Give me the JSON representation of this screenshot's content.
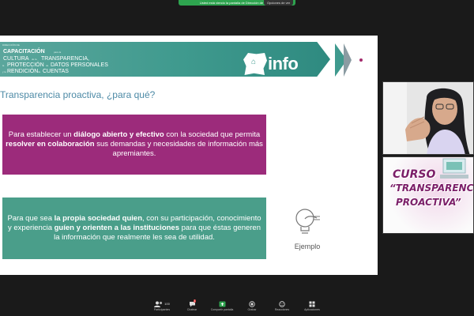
{
  "top_bar": {
    "share_notice": "Usted está viendo la pantalla de Dirección de Capa...",
    "view_options": "Opciones de ver"
  },
  "slide": {
    "banner": {
      "line1_prefix": "DIRECCIÓN DE",
      "line1": "CAPACITACIÓN",
      "line1_suffix": "para la",
      "line2": "CULTURA",
      "line2_mid": "de la",
      "line2b": "TRANSPARENCIA,",
      "line3_prefix": "la",
      "line3": "PROTECCIÓN",
      "line3_mid": "de",
      "line3b": "DATOS PERSONALES",
      "line4_prefix": "y la",
      "line4": "RENDICIÓN",
      "line4_mid": "de",
      "line4b": "CUENTAS"
    },
    "logo_text": "info",
    "heading": "Transparencia proactiva, ¿para qué?",
    "box1": {
      "t1": "Para establecer un ",
      "b1": "diálogo abierto y efectivo",
      "t2": " con la sociedad que permita ",
      "b2": "resolver en colaboración",
      "t3": " sus demandas y necesidades de información más apremiantes."
    },
    "box2": {
      "t1": "Para que sea ",
      "b1": "la propia sociedad quien",
      "t2": ", con su participación, conocimiento y experiencia ",
      "b2": "guíen y orienten a las instituciones",
      "t3": " para que éstas generen la información que realmente les sea de utilidad."
    },
    "ejemplo_label": "Ejemplo"
  },
  "course_tile": {
    "line1": "CURSO",
    "line2": "“TRANSPARENCIA",
    "line3": "PROACTIVA”"
  },
  "toolbar": {
    "items": [
      {
        "label": "Participantes",
        "icon": "participants-icon"
      },
      {
        "label": "Chatear",
        "icon": "chat-icon"
      },
      {
        "label": "Compartir pantalla",
        "icon": "share-screen-icon"
      },
      {
        "label": "Grabar",
        "icon": "record-icon"
      },
      {
        "label": "Reacciones",
        "icon": "reactions-icon"
      },
      {
        "label": "Aplicaciones",
        "icon": "apps-icon"
      }
    ],
    "participants_count": "100",
    "chat_badge": "1"
  },
  "colors": {
    "magenta_box": "#9c2b7b",
    "teal_box": "#4a9e8a",
    "banner_teal": "#3f9a8e",
    "heading_blue": "#4d8aa6",
    "share_green": "#2ea44f"
  }
}
